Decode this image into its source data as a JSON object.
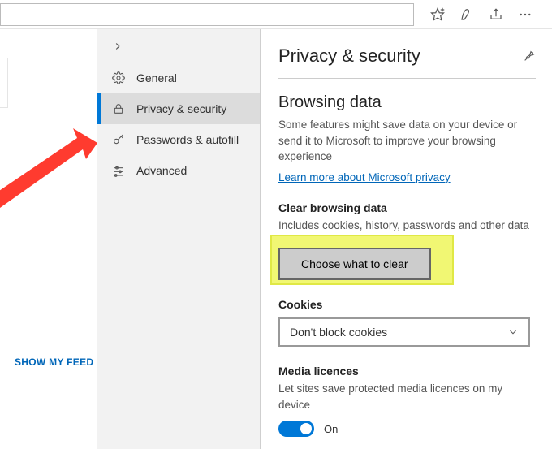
{
  "sidebar_left": {
    "show_feed": "SHOW MY FEED"
  },
  "nav": {
    "items": [
      {
        "label": "General"
      },
      {
        "label": "Privacy & security"
      },
      {
        "label": "Passwords & autofill"
      },
      {
        "label": "Advanced"
      }
    ]
  },
  "detail": {
    "title": "Privacy & security",
    "browsing": {
      "heading": "Browsing data",
      "desc": "Some features might save data on your device or send it to Microsoft to improve your browsing experience",
      "link": "Learn more about Microsoft privacy"
    },
    "clear": {
      "heading": "Clear browsing data",
      "desc": "Includes cookies, history, passwords and other data",
      "button": "Choose what to clear"
    },
    "cookies": {
      "heading": "Cookies",
      "value": "Don't block cookies"
    },
    "media": {
      "heading": "Media licences",
      "desc": "Let sites save protected media licences on my device",
      "toggle_label": "On"
    }
  }
}
